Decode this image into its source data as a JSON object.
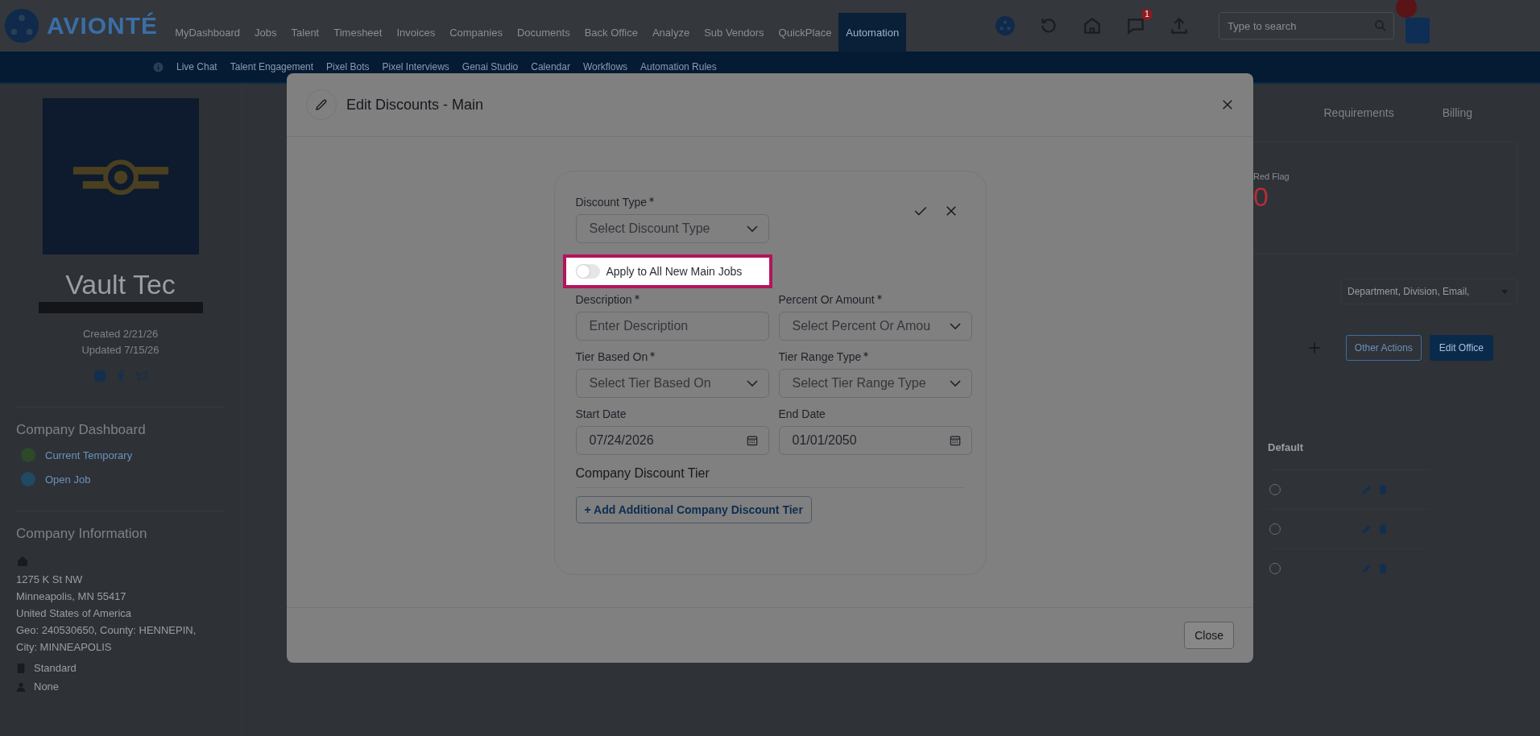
{
  "app_bar": {
    "brand": "AVIONTÉ",
    "nav": [
      {
        "label": "MyDashboard",
        "selected": false
      },
      {
        "label": "Jobs",
        "selected": false
      },
      {
        "label": "Talent",
        "selected": false
      },
      {
        "label": "Timesheet",
        "selected": false
      },
      {
        "label": "Invoices",
        "selected": false
      },
      {
        "label": "Companies",
        "selected": false
      },
      {
        "label": "Documents",
        "selected": false
      },
      {
        "label": "Back Office",
        "selected": false
      },
      {
        "label": "Analyze",
        "selected": false
      },
      {
        "label": "Sub Vendors",
        "selected": false
      },
      {
        "label": "QuickPlace",
        "selected": false
      },
      {
        "label": "Automation",
        "selected": true
      }
    ],
    "notification_count": "1",
    "search": {
      "placeholder": "Type to search"
    }
  },
  "sub_nav": [
    "Live Chat",
    "Talent Engagement",
    "Pixel Bots",
    "Pixel Interviews",
    "Genai Studio",
    "Calendar",
    "Workflows",
    "Automation Rules"
  ],
  "company": {
    "name": "Vault Tec",
    "created": "Created 2/21/26",
    "updated": "Updated 7/15/26",
    "dashboard_title": "Company Dashboard",
    "dashboard_items": [
      {
        "label": "Current Temporary",
        "color": "#2c4a2a"
      },
      {
        "label": "Open Job",
        "color": "#1f4a63"
      }
    ],
    "info_title": "Company Information",
    "address": [
      "1275 K St NW",
      "Minneapolis, MN 55417",
      "United States of America",
      "Geo: 240530650, County: HENNEPIN,",
      "City: MINNEAPOLIS"
    ],
    "details": [
      {
        "kind": "document",
        "text": "Standard"
      },
      {
        "kind": "person",
        "text": "None"
      }
    ]
  },
  "main": {
    "tabs": [
      "Requirements",
      "Billing"
    ],
    "stat": {
      "label": "Red Flag",
      "value": "0"
    },
    "filter": "Department, Division, Email,",
    "buttons": [
      "Other Actions",
      "Edit Office"
    ],
    "table": {
      "columns": [
        "Default"
      ],
      "rows": [
        {
          "selected": false
        },
        {
          "selected": false
        },
        {
          "selected": false
        }
      ]
    }
  },
  "modal": {
    "title": "Edit Discounts - Main",
    "discount_type": {
      "label": "Discount Type",
      "required": true,
      "placeholder": "Select Discount Type"
    },
    "toggle": {
      "label": "Apply to All New Main Jobs",
      "on": false,
      "highlighted": true
    },
    "fields": [
      {
        "kind": "text",
        "label": "Description",
        "required": true,
        "placeholder": "Enter Description"
      },
      {
        "kind": "select",
        "label": "Percent Or Amount",
        "required": true,
        "placeholder": "Select Percent Or Amou"
      },
      {
        "kind": "select",
        "label": "Tier Based On",
        "required": true,
        "placeholder": "Select Tier Based On"
      },
      {
        "kind": "select",
        "label": "Tier Range Type",
        "required": true,
        "placeholder": "Select Tier Range Type"
      },
      {
        "kind": "date",
        "label": "Start Date",
        "required": false,
        "value": "07/24/2026"
      },
      {
        "kind": "date",
        "label": "End Date",
        "required": false,
        "value": "01/01/2050"
      }
    ],
    "section_title": "Company Discount Tier",
    "add_button": "+ Add Additional Company Discount Tier",
    "footer_button": "Close"
  }
}
